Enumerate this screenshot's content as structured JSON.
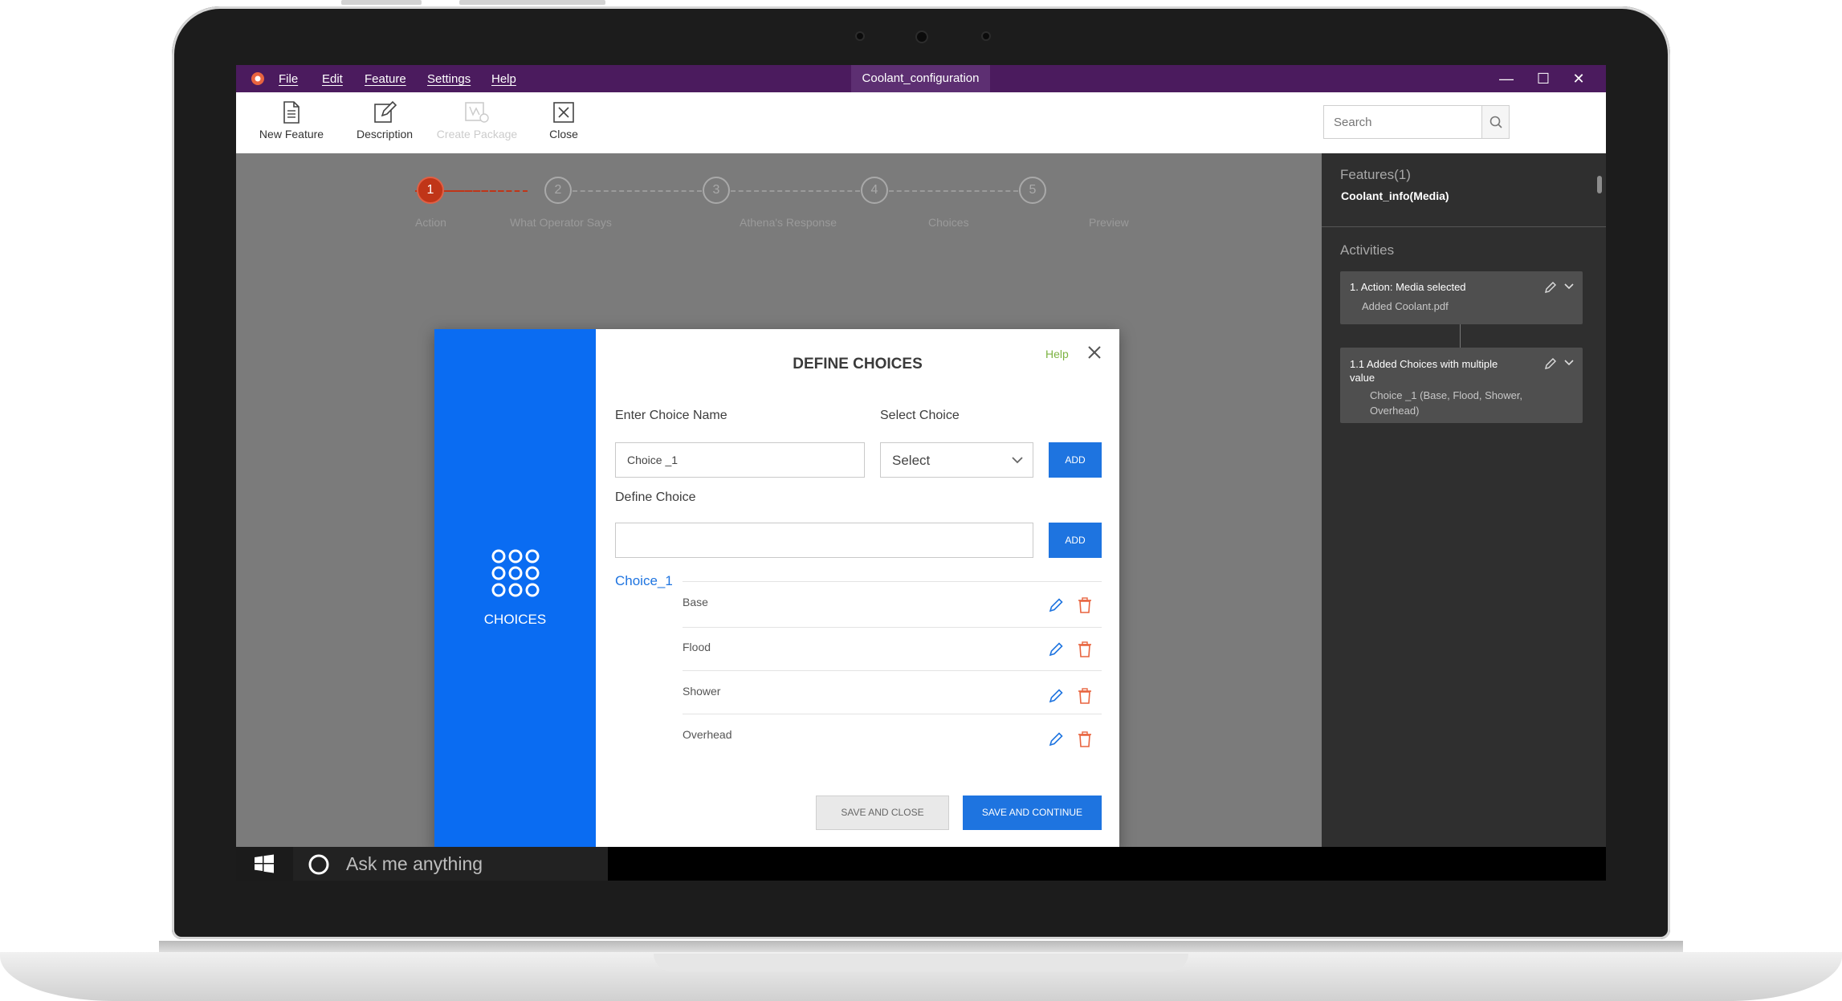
{
  "window": {
    "menu": [
      "File",
      "Edit",
      "Feature",
      "Settings",
      "Help"
    ],
    "document_title": "Coolant_configuration",
    "controls": [
      "minimize",
      "maximize",
      "close"
    ]
  },
  "toolbar": {
    "new_feature": "New Feature",
    "description": "Description",
    "create_package": "Create Package",
    "close": "Close"
  },
  "search": {
    "placeholder": "Search",
    "icon": "magnifier-icon"
  },
  "stepper": {
    "steps": [
      {
        "num": "1",
        "label": "Action"
      },
      {
        "num": "2",
        "label": "What Operator Says"
      },
      {
        "num": "3",
        "label": "Athena's Response"
      },
      {
        "num": "4",
        "label": "Choices"
      },
      {
        "num": "5",
        "label": "Preview"
      }
    ],
    "active_step": 1
  },
  "dialog": {
    "title": "DEFINE CHOICES",
    "help": "Help",
    "side_label": "CHOICES",
    "choice_name_label": "Enter Choice Name",
    "choice_name_value": "Choice _1",
    "select_choice_label": "Select Choice",
    "select_value": "Select",
    "add_label": "ADD",
    "define_choice_label": "Define Choice",
    "define_choice_value": "",
    "group_name": "Choice_1",
    "items": [
      "Base",
      "Flood",
      "Shower",
      "Overhead"
    ],
    "save_close": "SAVE AND CLOSE",
    "save_continue": "SAVE AND CONTINUE"
  },
  "panel": {
    "features_title": "Features(1)",
    "feature_item": "Coolant_info(Media)",
    "activities_title": "Activities",
    "activities": [
      {
        "title": "1. Action: Media selected",
        "detail": "Added Coolant.pdf"
      },
      {
        "title": "1.1 Added Choices with multiple value",
        "detail": "Choice _1 (Base, Flood, Shower, Overhead)"
      }
    ]
  },
  "taskbar": {
    "search_prompt": "Ask me anything"
  },
  "colors": {
    "titlebar": "#4b1b5e",
    "accent_blue": "#1e74e0",
    "dialog_side": "#0a6cf2",
    "step_active": "#c03518",
    "help_green": "#7cb342",
    "delete_red": "#e8643f"
  }
}
